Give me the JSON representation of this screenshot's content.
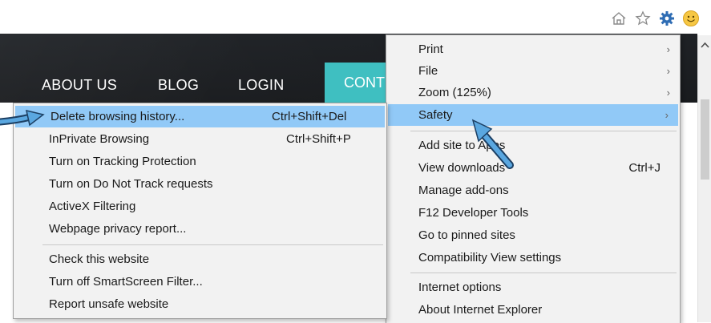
{
  "toolbar": {
    "icons": [
      "home-icon",
      "star-icon",
      "gear-icon",
      "smiley-icon"
    ]
  },
  "website": {
    "nav": {
      "about": "ABOUT US",
      "blog": "BLOG",
      "login": "LOGIN",
      "contact": "CONT"
    },
    "accent_color": "#3fbfc1"
  },
  "tools_menu": {
    "items": [
      {
        "label": "Print",
        "has_submenu": true
      },
      {
        "label": "File",
        "has_submenu": true
      },
      {
        "label": "Zoom (125%)",
        "has_submenu": true
      },
      {
        "label": "Safety",
        "has_submenu": true,
        "highlighted": true
      },
      {
        "label": "Add site to Apps"
      },
      {
        "label": "View downloads",
        "shortcut": "Ctrl+J"
      },
      {
        "label": "Manage add-ons"
      },
      {
        "label": "F12 Developer Tools"
      },
      {
        "label": "Go to pinned sites"
      },
      {
        "label": "Compatibility View settings"
      },
      {
        "label": "Internet options"
      },
      {
        "label": "About Internet Explorer"
      }
    ]
  },
  "safety_menu": {
    "items": [
      {
        "label": "Delete browsing history...",
        "shortcut": "Ctrl+Shift+Del",
        "highlighted": true
      },
      {
        "label": "InPrivate Browsing",
        "shortcut": "Ctrl+Shift+P"
      },
      {
        "label": "Turn on Tracking Protection"
      },
      {
        "label": "Turn on Do Not Track requests"
      },
      {
        "label": "ActiveX Filtering"
      },
      {
        "label": "Webpage privacy report..."
      },
      {
        "label": "Check this website"
      },
      {
        "label": "Turn off SmartScreen Filter..."
      },
      {
        "label": "Report unsafe website"
      }
    ]
  },
  "highlight_color": "#91c9f7",
  "annotation_arrow_color": "#5aa7e0"
}
